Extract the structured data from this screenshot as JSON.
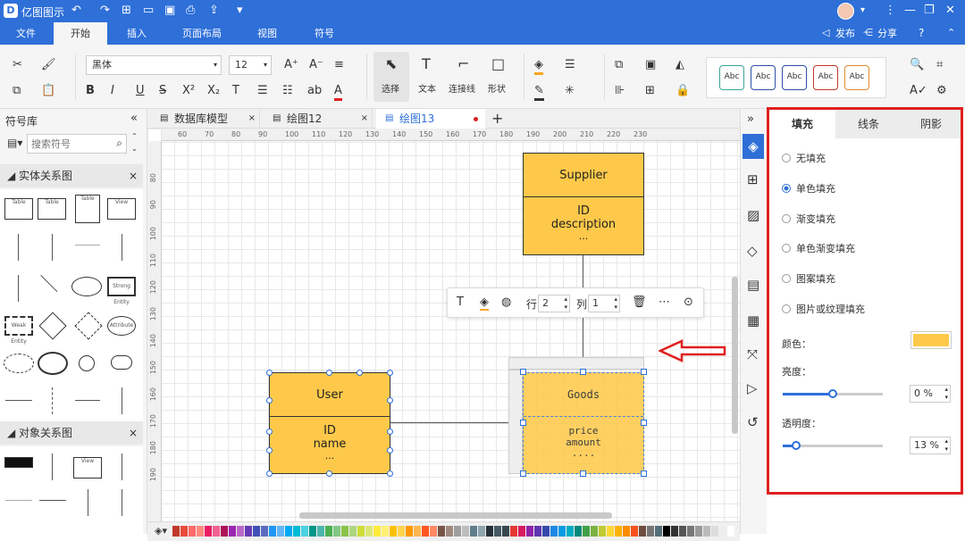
{
  "app": {
    "title": "亿图图示",
    "tabs": [
      "文件",
      "开始",
      "插入",
      "页面布局",
      "视图",
      "符号"
    ],
    "publish": "发布",
    "share": "分享"
  },
  "ribbon": {
    "font": "黑体",
    "size": "12",
    "select": "选择",
    "text": "文本",
    "connector": "连接线",
    "shape": "形状",
    "style_label": "Abc",
    "style_colors": [
      "#3aa59a",
      "#2e4fa8",
      "#2e4fa8",
      "#c0392b",
      "#e08a2e"
    ]
  },
  "left": {
    "title": "符号库",
    "search_placeholder": "搜索符号",
    "section1": "实体关系图",
    "section2": "对象关系图",
    "shape_labels": [
      "Table",
      "Table",
      "Table",
      "View",
      "Strong Entity",
      "Weak Entity",
      "Strong",
      "Weak",
      "Attribute",
      "Derived attribute",
      "Multi-valued attribute",
      "View"
    ]
  },
  "doc_tabs": [
    "数据库模型",
    "绘图12",
    "绘图13"
  ],
  "ruler": {
    "h": [
      "60",
      "70",
      "80",
      "90",
      "100",
      "110",
      "120",
      "130",
      "140",
      "150",
      "160",
      "170",
      "180",
      "190",
      "200",
      "210",
      "220",
      "230"
    ],
    "v": [
      "80",
      "90",
      "100",
      "110",
      "120",
      "130",
      "140",
      "150",
      "160",
      "170",
      "180",
      "190"
    ]
  },
  "diagram": {
    "supplier": {
      "title": "Supplier",
      "body": [
        "ID",
        "description",
        "..."
      ]
    },
    "user": {
      "title": "User",
      "body": [
        "ID",
        "name",
        "..."
      ]
    },
    "goods": {
      "title": "Goods",
      "body": [
        "price",
        "amount",
        "...."
      ]
    }
  },
  "floatbar": {
    "row_label": "行",
    "row_val": "2",
    "col_label": "列",
    "col_val": "1"
  },
  "right": {
    "tabs": [
      "填充",
      "线条",
      "阴影"
    ],
    "options": [
      "无填充",
      "单色填充",
      "渐变填充",
      "单色渐变填充",
      "图案填充",
      "图片或纹理填充"
    ],
    "color_label": "颜色：",
    "fill_color": "#fec94a",
    "brightness_label": "亮度：",
    "brightness_val": "0 %",
    "brightness": 0.5,
    "opacity_label": "透明度：",
    "opacity_val": "13 %",
    "opacity": 0.13
  },
  "palette": [
    "#c0392b",
    "#e74c3c",
    "#ff6b6b",
    "#ff8a80",
    "#e91e63",
    "#f06292",
    "#ad1457",
    "#9c27b0",
    "#ba68c8",
    "#673ab7",
    "#3f51b5",
    "#5c6bc0",
    "#2196f3",
    "#64b5f6",
    "#03a9f4",
    "#00bcd4",
    "#4dd0e1",
    "#009688",
    "#4db6ac",
    "#4caf50",
    "#81c784",
    "#8bc34a",
    "#aed581",
    "#cddc39",
    "#dce775",
    "#ffeb3b",
    "#fff176",
    "#ffc107",
    "#ffd54f",
    "#ff9800",
    "#ffb74d",
    "#ff5722",
    "#ff8a65",
    "#795548",
    "#a1887f",
    "#9e9e9e",
    "#bdbdbd",
    "#607d8b",
    "#90a4ae",
    "#263238",
    "#455a64",
    "#37474f",
    "#e53935",
    "#d81b60",
    "#8e24aa",
    "#5e35b1",
    "#3949ab",
    "#1e88e5",
    "#039be5",
    "#00acc1",
    "#00897b",
    "#43a047",
    "#7cb342",
    "#c0ca33",
    "#fdd835",
    "#ffb300",
    "#fb8c00",
    "#f4511e",
    "#6d4c41",
    "#757575",
    "#546e7a",
    "#000000",
    "#333333",
    "#555555",
    "#777777",
    "#999999",
    "#bbbbbb",
    "#dddddd",
    "#eeeeee",
    "#ffffff"
  ]
}
